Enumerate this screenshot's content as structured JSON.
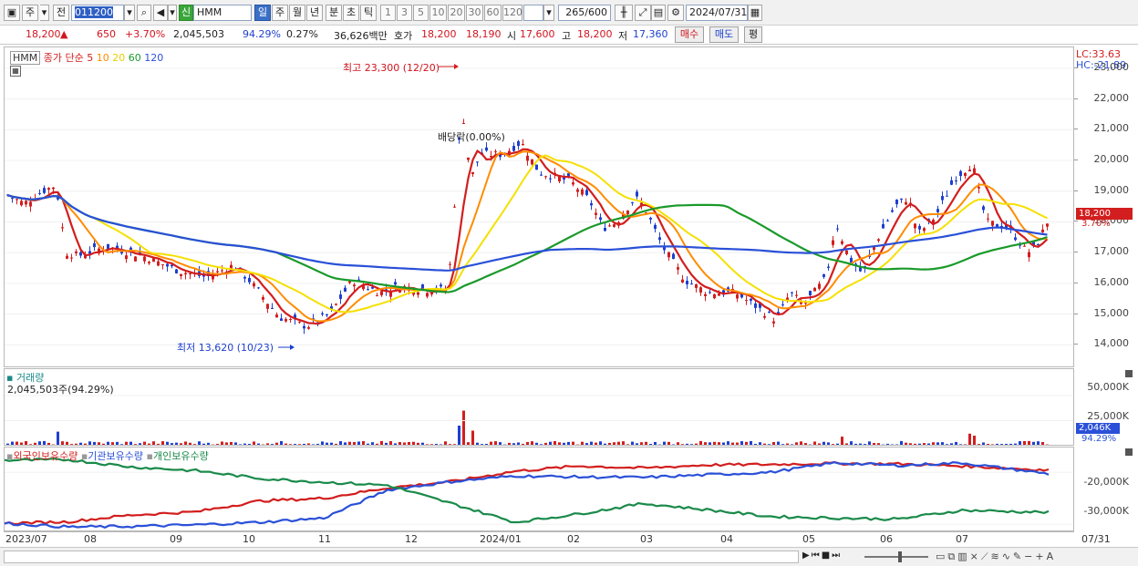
{
  "toolbar": {
    "period_button": "주",
    "prev_button": "전",
    "stock_code": "011200",
    "stock_name": "HMM",
    "new_badge": "신",
    "timeframes": [
      "일",
      "주",
      "월",
      "년",
      "분",
      "초",
      "틱"
    ],
    "intervals": [
      "1",
      "3",
      "5",
      "10",
      "20",
      "30",
      "60",
      "120"
    ],
    "count": "265",
    "count_total": "/600",
    "date": "2024/07/31"
  },
  "quote": {
    "price": "18,200",
    "change": "650",
    "change_pct": "+3.70%",
    "volume": "2,045,503",
    "volume_ratio": "94.29%",
    "turnover_pct": "0.27%",
    "amount": "36,626백만",
    "bid_label": "호가",
    "ask": "18,200",
    "bid": "18,190",
    "open_label": "시",
    "open": "17,600",
    "high_label": "고",
    "high": "18,200",
    "low_label": "저",
    "low": "17,360",
    "buy_button": "매수",
    "sell_button": "매도",
    "eval_button": "평"
  },
  "price_pane": {
    "name_tag": "HMM",
    "legend_prefix": "종가 단순",
    "ma_periods": [
      "5",
      "10",
      "20",
      "60",
      "120"
    ],
    "ma_colors": [
      "#d21e1e",
      "#ff8c00",
      "#f5e000",
      "#1a9a2a",
      "#2a50d8"
    ],
    "high_annotation": "최고 23,300 (12/20)",
    "low_annotation": "최저 13,620 (10/23)",
    "dividend_annotation": "배당락(0.00%)",
    "lc_label": "LC:33.63",
    "hc_label": "HC:-21.89",
    "price_levels": [
      "23,000",
      "22,000",
      "21,000",
      "20,000",
      "19,000",
      "18,000",
      "17,000",
      "16,000",
      "15,000",
      "14,000"
    ],
    "current_price_tag": "18,200",
    "current_pct_tag": "3.70%"
  },
  "volume_pane": {
    "title": "거래량",
    "value": "2,045,503주(94.29%)",
    "levels": [
      "50,000K",
      "25,000K"
    ],
    "current_tag": "2,046K",
    "current_pct": "94.29%"
  },
  "holding_pane": {
    "legend": [
      "외국인보유수량",
      "기관보유수량",
      "개인보유수량"
    ],
    "legend_colors": [
      "#d21e1e",
      "#2a50d8",
      "#1a8a4a"
    ],
    "levels": [
      "-20,000K",
      "-30,000K"
    ]
  },
  "time_axis": {
    "labels": [
      "2023/07",
      "08",
      "09",
      "10",
      "11",
      "12",
      "2024/01",
      "02",
      "03",
      "04",
      "05",
      "06",
      "07"
    ],
    "right_label": "07/31"
  },
  "chart_data": {
    "type": "line",
    "title": "",
    "price_ylim": [
      13300,
      23500
    ],
    "close_anchors": [
      [
        0,
        18900
      ],
      [
        20,
        18600
      ],
      [
        40,
        19000
      ],
      [
        55,
        19200
      ],
      [
        66,
        17000
      ],
      [
        80,
        16900
      ],
      [
        110,
        17200
      ],
      [
        150,
        16900
      ],
      [
        190,
        16400
      ],
      [
        220,
        16200
      ],
      [
        250,
        16600
      ],
      [
        270,
        16000
      ],
      [
        300,
        14900
      ],
      [
        330,
        14600
      ],
      [
        355,
        15000
      ],
      [
        380,
        16100
      ],
      [
        410,
        15700
      ],
      [
        430,
        15900
      ],
      [
        460,
        15800
      ],
      [
        485,
        15800
      ],
      [
        500,
        21800
      ],
      [
        510,
        19400
      ],
      [
        520,
        20200
      ],
      [
        545,
        20200
      ],
      [
        565,
        20600
      ],
      [
        585,
        19600
      ],
      [
        600,
        19500
      ],
      [
        620,
        19300
      ],
      [
        640,
        18700
      ],
      [
        655,
        17800
      ],
      [
        670,
        18000
      ],
      [
        690,
        18800
      ],
      [
        700,
        18500
      ],
      [
        720,
        17200
      ],
      [
        745,
        16100
      ],
      [
        770,
        15700
      ],
      [
        800,
        15700
      ],
      [
        820,
        15300
      ],
      [
        845,
        14800
      ],
      [
        860,
        15700
      ],
      [
        875,
        15300
      ],
      [
        900,
        16200
      ],
      [
        910,
        18000
      ],
      [
        925,
        16800
      ],
      [
        940,
        16300
      ],
      [
        955,
        17400
      ],
      [
        975,
        18500
      ],
      [
        990,
        18800
      ],
      [
        1000,
        17600
      ],
      [
        1020,
        18200
      ],
      [
        1040,
        19400
      ],
      [
        1060,
        19900
      ],
      [
        1075,
        18000
      ],
      [
        1100,
        17800
      ],
      [
        1120,
        17000
      ],
      [
        1130,
        17200
      ],
      [
        1145,
        18200
      ]
    ],
    "volume_max": 60000,
    "volume_spikes": [
      [
        500,
        55000
      ],
      [
        504,
        35000
      ],
      [
        498,
        20000
      ],
      [
        510,
        15000
      ],
      [
        58,
        14000
      ],
      [
        915,
        9000
      ],
      [
        1055,
        12000
      ],
      [
        1060,
        10000
      ]
    ],
    "series": [
      {
        "name": "외국인보유수량",
        "values": [
          -29800,
          -29500,
          -28200,
          -27600,
          -25500,
          -25000,
          -23000,
          -21800,
          -19800,
          -18800,
          -19200,
          -18600,
          -18500,
          -18300,
          -18400,
          -18800,
          -19600
        ]
      },
      {
        "name": "기관보유수량",
        "values": [
          -29800,
          -30500,
          -30400,
          -30100,
          -29600,
          -28800,
          -23400,
          -21800,
          -20700,
          -20900,
          -21000,
          -20500,
          -20000,
          -18200,
          -18700,
          -18200,
          -20300
        ]
      },
      {
        "name": "개인보유수량",
        "values": [
          -17700,
          -17600,
          -19000,
          -19700,
          -21200,
          -21900,
          -22500,
          -26000,
          -29600,
          -28000,
          -26000,
          -27200,
          -28500,
          -28800,
          -29000,
          -27300,
          -27700
        ]
      }
    ],
    "holding_x": [
      0,
      70,
      140,
      210,
      280,
      350,
      420,
      490,
      560,
      630,
      700,
      770,
      840,
      910,
      980,
      1050,
      1145
    ],
    "holding_ylim": [
      -31000,
      -17000
    ]
  }
}
